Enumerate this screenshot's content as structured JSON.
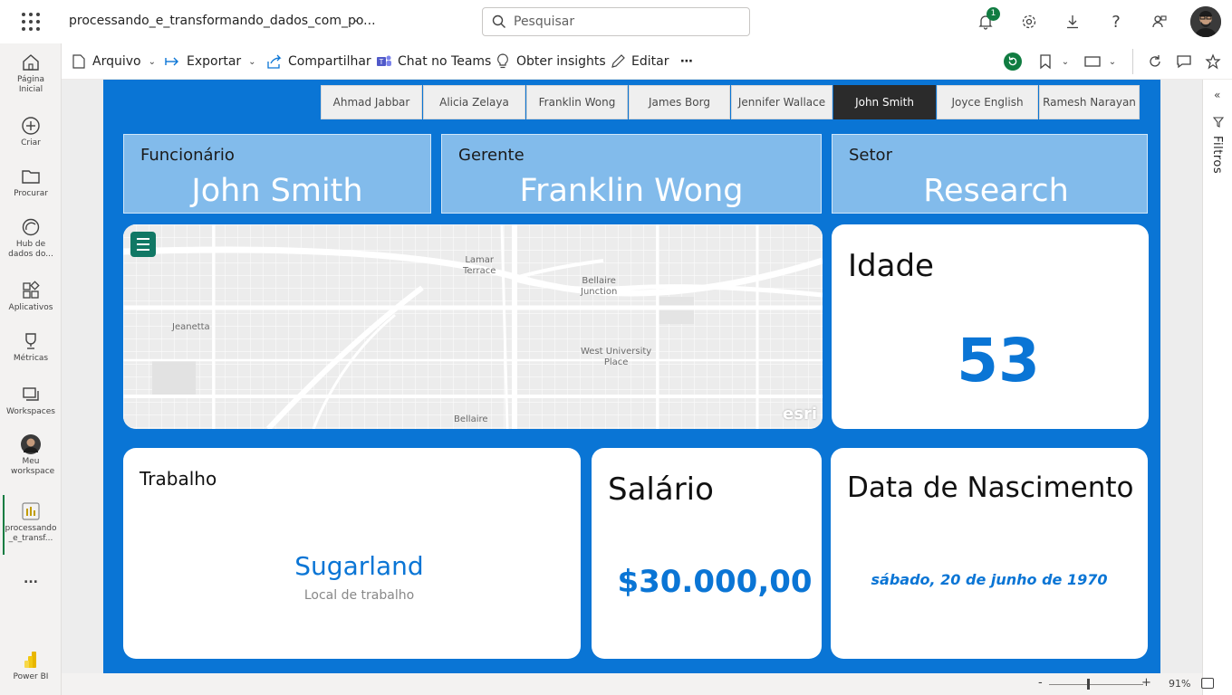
{
  "header": {
    "doc_title": "processando_e_transformando_dados_com_po...",
    "search_placeholder": "Pesquisar",
    "notification_count": "1"
  },
  "nav": {
    "items": [
      {
        "label": "Página Inicial",
        "icon": "home-icon"
      },
      {
        "label": "Criar",
        "icon": "plus-circle-icon"
      },
      {
        "label": "Procurar",
        "icon": "folder-icon"
      },
      {
        "label": "Hub de dados do...",
        "icon": "data-hub-icon"
      },
      {
        "label": "Aplicativos",
        "icon": "apps-icon"
      },
      {
        "label": "Métricas",
        "icon": "trophy-icon"
      },
      {
        "label": "Workspaces",
        "icon": "workspaces-icon"
      },
      {
        "label": "Meu workspace",
        "icon": "avatar"
      },
      {
        "label": "processando_e_transf...",
        "icon": "report-icon"
      }
    ],
    "more": "...",
    "brand": "Power BI"
  },
  "toolbar": {
    "arquivo": "Arquivo",
    "exportar": "Exportar",
    "compartilhar": "Compartilhar",
    "chat_teams": "Chat no Teams",
    "insights": "Obter insights",
    "editar": "Editar",
    "more": "⋯"
  },
  "report": {
    "slicer_items": [
      "Ahmad Jabbar",
      "Alicia Zelaya",
      "Franklin Wong",
      "James Borg",
      "Jennifer Wallace",
      "John Smith",
      "Joyce English",
      "Ramesh Narayan"
    ],
    "selected": "John Smith",
    "kpis": {
      "funcionario": {
        "label": "Funcionário",
        "value": "John Smith"
      },
      "gerente": {
        "label": "Gerente",
        "value": "Franklin Wong"
      },
      "setor": {
        "label": "Setor",
        "value": "Research"
      }
    },
    "map": {
      "labels": {
        "lamar": "Lamar\nTerrace",
        "bellaire_junction": "Bellaire\nJunction",
        "jeanetta": "Jeanetta",
        "west_university": "West University\nPlace",
        "bellaire": "Bellaire"
      },
      "attribution": "esri"
    },
    "idade": {
      "label": "Idade",
      "value": "53"
    },
    "trabalho": {
      "label": "Trabalho",
      "value": "Sugarland",
      "sub": "Local de trabalho"
    },
    "salario": {
      "label": "Salário",
      "value": "$30.000,00"
    },
    "nascimento": {
      "label": "Data de Nascimento",
      "value": "sábado, 20 de junho de 1970"
    }
  },
  "filters": {
    "label": "Filtros"
  },
  "status": {
    "zoom": "91%",
    "minus": "-",
    "plus": "+"
  },
  "colors": {
    "accent": "#0a75d5",
    "kpi_bg": "#82bbeb",
    "selected_slicer": "#2b2b2b",
    "brand_green": "#107c41"
  }
}
